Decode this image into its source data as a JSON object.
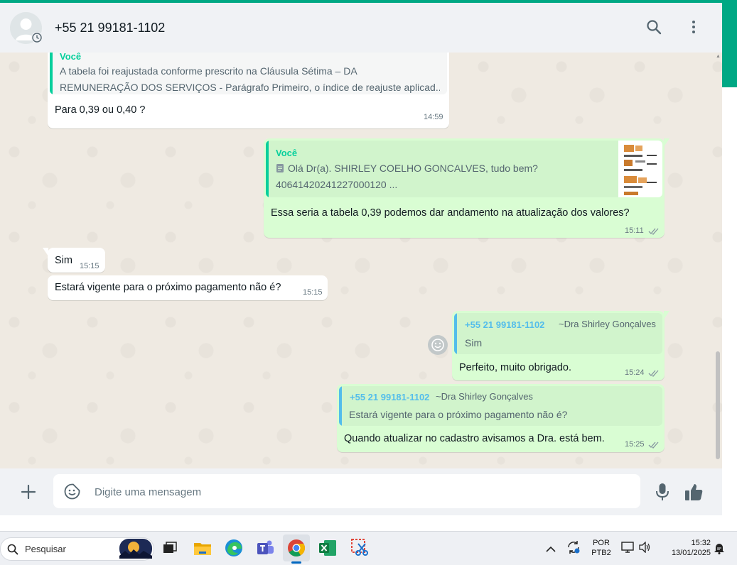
{
  "header": {
    "contact": "+55 21 99181-1102",
    "icons": [
      "search-icon",
      "menu-kebab-icon"
    ]
  },
  "messages": [
    {
      "direction": "in",
      "quote": {
        "author": "Você",
        "lines": [
          "A tabela foi reajustada conforme prescrito na Cláusula Sétima – DA",
          "REMUNERAÇÃO DOS SERVIÇOS - Parágrafo Primeiro, o índice de reajuste aplicad..."
        ]
      },
      "text": "Para 0,39 ou 0,40 ?",
      "time": "14:59"
    },
    {
      "direction": "out",
      "quote": {
        "author": "Você",
        "lines": [
          "Olá Dr(a). SHIRLEY COELHO GONCALVES, tudo bem?",
          "40641420241227000120 ..."
        ],
        "has_document_icon": true,
        "has_thumbnail": true
      },
      "text": "Essa seria a tabela 0,39 podemos dar andamento na atualização dos valores?",
      "time": "15:11",
      "status": "read"
    },
    {
      "direction": "in",
      "text": "Sim",
      "time": "15:15"
    },
    {
      "direction": "in",
      "text": "Estará vigente para o próximo pagamento não é?",
      "time": "15:15"
    },
    {
      "direction": "out",
      "quote": {
        "author": "+55 21 99181-1102",
        "push_name": "~Dra Shirley Gonçalves",
        "lines": [
          "Sim"
        ]
      },
      "text": "Perfeito, muito obrigado.",
      "time": "15:24",
      "status": "read"
    },
    {
      "direction": "out",
      "quote": {
        "author": "+55 21 99181-1102",
        "push_name": "~Dra Shirley Gonçalves",
        "lines": [
          "Estará vigente para o próximo pagamento não é?"
        ]
      },
      "text": "Quando atualizar no cadastro avisamos a Dra. está bem.",
      "time": "15:25",
      "status": "read"
    }
  ],
  "composer": {
    "placeholder": "Digite uma mensagem",
    "icons": [
      "plus-icon",
      "sticker-icon",
      "microphone-icon",
      "thumbs-up-icon"
    ]
  },
  "taskbar": {
    "search_label": "Pesquisar",
    "apps": [
      "task-view",
      "file-explorer",
      "edge",
      "teams",
      "chrome",
      "excel",
      "snipping-tool"
    ],
    "active_app": "chrome",
    "language_line1": "POR",
    "language_line2": "PTB2",
    "time": "15:32",
    "date": "13/01/2025"
  },
  "colors": {
    "accent": "#00a884",
    "outgoing_bubble": "#d9fdd3",
    "incoming_bubble": "#ffffff",
    "quote_name_self": "#06cf9c",
    "quote_name_contact": "#53bdeb",
    "read_ticks": "#8696a0"
  }
}
